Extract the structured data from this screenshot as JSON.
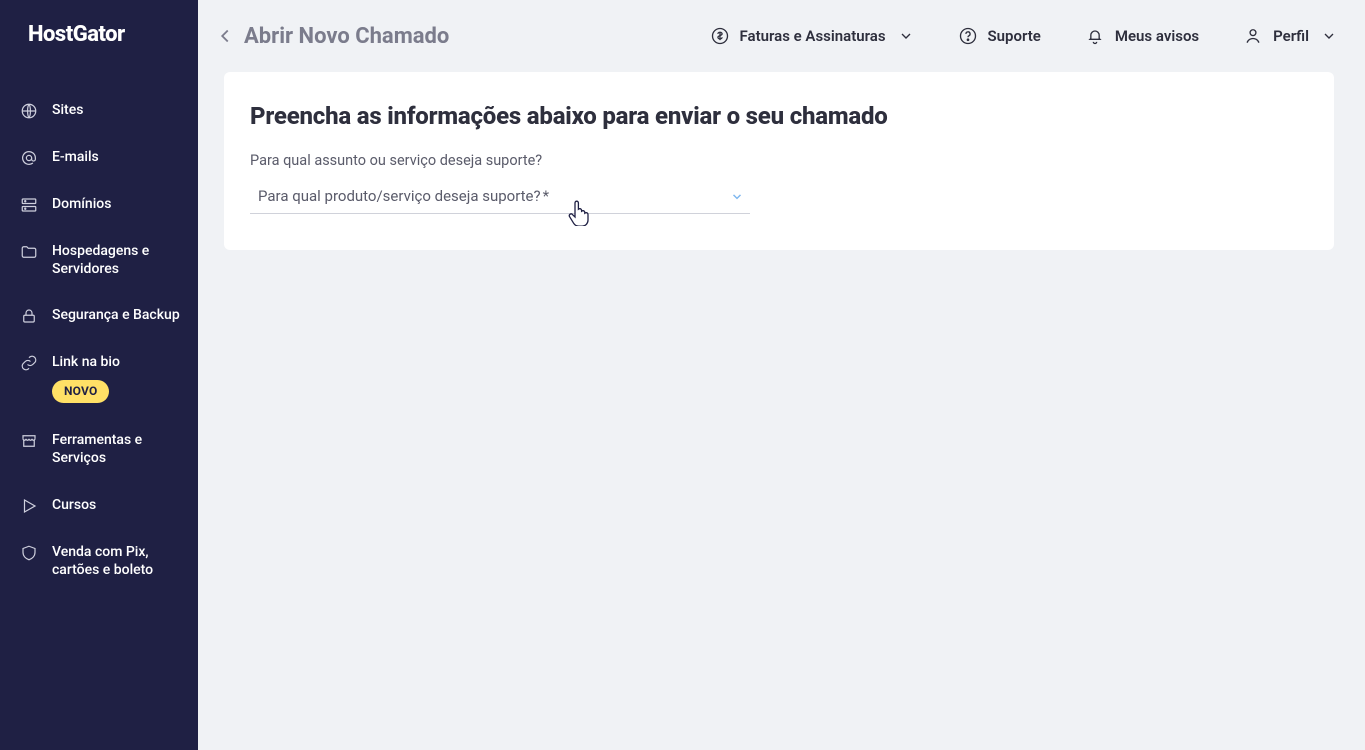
{
  "brand": {
    "name": "HostGator"
  },
  "sidebar": {
    "items": [
      {
        "label": "Sites"
      },
      {
        "label": "E-mails"
      },
      {
        "label": "Domínios"
      },
      {
        "label": "Hospedagens e Servidores"
      },
      {
        "label": "Segurança e Backup"
      },
      {
        "label": "Link na bio",
        "badge": "NOVO"
      },
      {
        "label": "Ferramentas e Serviços"
      },
      {
        "label": "Cursos"
      },
      {
        "label": "Venda com Pix, cartões e boleto"
      }
    ]
  },
  "header": {
    "page_title": "Abrir Novo Chamado",
    "invoices": "Faturas e Assinaturas",
    "support": "Suporte",
    "notifications": "Meus avisos",
    "profile": "Perfil"
  },
  "form": {
    "title": "Preencha as informações abaixo para enviar o seu chamado",
    "question_label": "Para qual assunto ou serviço deseja suporte?",
    "select_placeholder": "Para qual produto/serviço deseja suporte?",
    "required_mark": "*"
  }
}
